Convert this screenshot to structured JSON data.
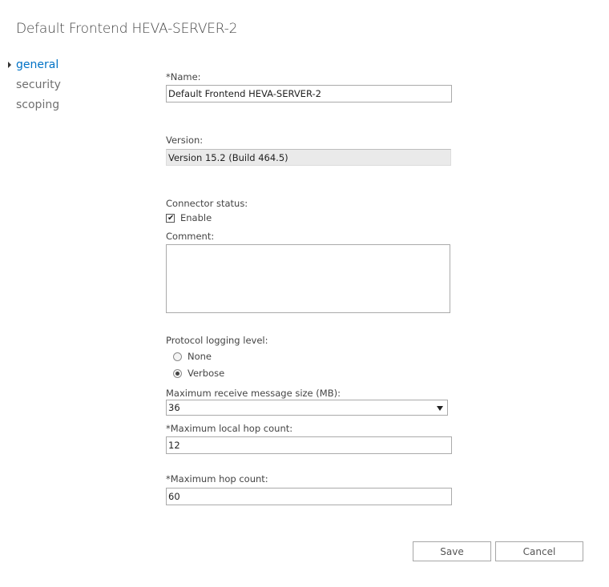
{
  "page": {
    "title": "Default Frontend HEVA-SERVER-2"
  },
  "nav": {
    "items": [
      {
        "label": "general",
        "active": true
      },
      {
        "label": "security",
        "active": false
      },
      {
        "label": "scoping",
        "active": false
      }
    ]
  },
  "form": {
    "name": {
      "label": "*Name:",
      "value": "Default Frontend HEVA-SERVER-2"
    },
    "version": {
      "label": "Version:",
      "value": "Version 15.2 (Build 464.5)"
    },
    "connector_status": {
      "label": "Connector status:",
      "enable_label": "Enable",
      "enabled": true
    },
    "comment": {
      "label": "Comment:",
      "value": ""
    },
    "protocol_logging": {
      "label": "Protocol logging level:",
      "options": [
        {
          "label": "None",
          "selected": false
        },
        {
          "label": "Verbose",
          "selected": true
        }
      ]
    },
    "max_receive_size": {
      "label": "Maximum receive message size (MB):",
      "value": "36"
    },
    "max_local_hop": {
      "label": "*Maximum local hop count:",
      "value": "12"
    },
    "max_hop": {
      "label": "*Maximum hop count:",
      "value": "60"
    }
  },
  "buttons": {
    "save_label": "Save",
    "cancel_label": "Cancel"
  },
  "icons": {
    "nav_active": "triangle-right-icon",
    "checkbox": "checkmark-icon",
    "dropdown": "chevron-down-icon"
  },
  "colors": {
    "accent": "#0072c6",
    "readonly_bg": "#eaeaea",
    "border": "#aaaaaa"
  }
}
